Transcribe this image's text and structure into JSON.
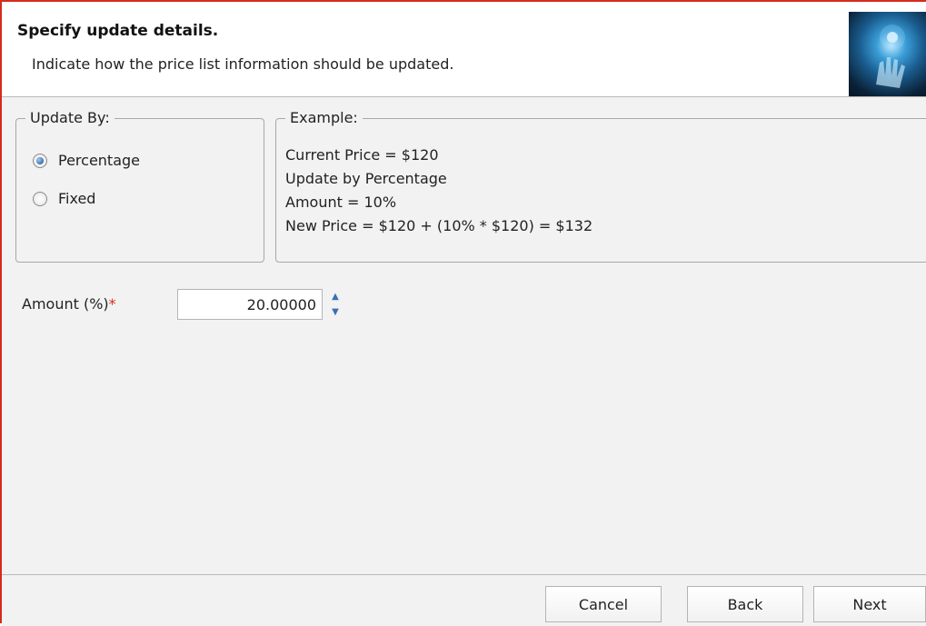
{
  "header": {
    "title": "Specify update details.",
    "subtitle": "Indicate how the price list information should be updated.",
    "logo_icon": "hand-light-icon"
  },
  "update_by": {
    "legend": "Update By:",
    "options": [
      {
        "label": "Percentage",
        "checked": true
      },
      {
        "label": "Fixed",
        "checked": false
      }
    ]
  },
  "example": {
    "legend": "Example:",
    "lines": [
      "Current Price = $120",
      "Update by Percentage",
      "Amount = 10%",
      "New Price = $120 + (10% * $120) = $132"
    ]
  },
  "amount": {
    "label": "Amount (%)",
    "required_mark": "*",
    "value": "20.00000"
  },
  "buttons": {
    "cancel": "Cancel",
    "back": "Back",
    "next": "Next"
  },
  "colors": {
    "accent_border": "#d52b1e",
    "radio_fill": "#3b6fb0"
  }
}
